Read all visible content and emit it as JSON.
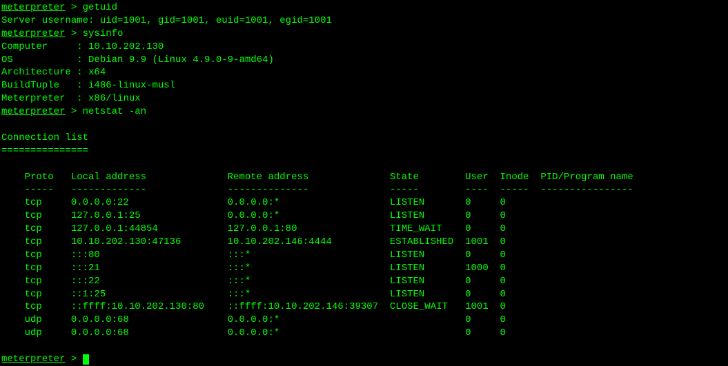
{
  "prompt": "meterpreter",
  "separator": " > ",
  "commands": {
    "getuid": "getuid",
    "sysinfo": "sysinfo",
    "netstat": "netstat -an"
  },
  "getuid_output": "Server username: uid=1001, gid=1001, euid=1001, egid=1001",
  "sysinfo": {
    "computer_label": "Computer     : ",
    "computer_value": "10.10.202.130",
    "os_label": "OS           : ",
    "os_value": "Debian 9.9 (Linux 4.9.0-9-amd64)",
    "arch_label": "Architecture : ",
    "arch_value": "x64",
    "buildtuple_label": "BuildTuple   : ",
    "buildtuple_value": "i486-linux-musl",
    "meterpreter_label": "Meterpreter  : ",
    "meterpreter_value": "x86/linux"
  },
  "netstat": {
    "title": "Connection list",
    "divider": "===============",
    "headers": {
      "proto": "Proto",
      "local": "Local address",
      "remote": "Remote address",
      "state": "State",
      "user": "User",
      "inode": "Inode",
      "pidprog": "PID/Program name"
    },
    "header_divider": {
      "proto": "-----",
      "local": "-------------",
      "remote": "--------------",
      "state": "-----",
      "user": "----",
      "inode": "-----",
      "pidprog": "----------------"
    },
    "rows": [
      {
        "proto": "tcp",
        "local": "0.0.0.0:22",
        "remote": "0.0.0.0:*",
        "state": "LISTEN",
        "user": "0",
        "inode": "0",
        "pidprog": ""
      },
      {
        "proto": "tcp",
        "local": "127.0.0.1:25",
        "remote": "0.0.0.0:*",
        "state": "LISTEN",
        "user": "0",
        "inode": "0",
        "pidprog": ""
      },
      {
        "proto": "tcp",
        "local": "127.0.0.1:44854",
        "remote": "127.0.0.1:80",
        "state": "TIME_WAIT",
        "user": "0",
        "inode": "0",
        "pidprog": ""
      },
      {
        "proto": "tcp",
        "local": "10.10.202.130:47136",
        "remote": "10.10.202.146:4444",
        "state": "ESTABLISHED",
        "user": "1001",
        "inode": "0",
        "pidprog": ""
      },
      {
        "proto": "tcp",
        "local": ":::80",
        "remote": ":::*",
        "state": "LISTEN",
        "user": "0",
        "inode": "0",
        "pidprog": ""
      },
      {
        "proto": "tcp",
        "local": ":::21",
        "remote": ":::*",
        "state": "LISTEN",
        "user": "1000",
        "inode": "0",
        "pidprog": ""
      },
      {
        "proto": "tcp",
        "local": ":::22",
        "remote": ":::*",
        "state": "LISTEN",
        "user": "0",
        "inode": "0",
        "pidprog": ""
      },
      {
        "proto": "tcp",
        "local": "::1:25",
        "remote": ":::*",
        "state": "LISTEN",
        "user": "0",
        "inode": "0",
        "pidprog": ""
      },
      {
        "proto": "tcp",
        "local": "::ffff:10.10.202.130:80",
        "remote": "::ffff:10.10.202.146:39307",
        "state": "CLOSE_WAIT",
        "user": "1001",
        "inode": "0",
        "pidprog": ""
      },
      {
        "proto": "udp",
        "local": "0.0.0.0:68",
        "remote": "0.0.0.0:*",
        "state": "",
        "user": "0",
        "inode": "0",
        "pidprog": ""
      },
      {
        "proto": "udp",
        "local": "0.0.0.0:68",
        "remote": "0.0.0.0:*",
        "state": "",
        "user": "0",
        "inode": "0",
        "pidprog": ""
      }
    ]
  },
  "chart_data": {
    "type": "table",
    "title": "Connection list",
    "columns": [
      "Proto",
      "Local address",
      "Remote address",
      "State",
      "User",
      "Inode",
      "PID/Program name"
    ],
    "rows": [
      [
        "tcp",
        "0.0.0.0:22",
        "0.0.0.0:*",
        "LISTEN",
        0,
        0,
        ""
      ],
      [
        "tcp",
        "127.0.0.1:25",
        "0.0.0.0:*",
        "LISTEN",
        0,
        0,
        ""
      ],
      [
        "tcp",
        "127.0.0.1:44854",
        "127.0.0.1:80",
        "TIME_WAIT",
        0,
        0,
        ""
      ],
      [
        "tcp",
        "10.10.202.130:47136",
        "10.10.202.146:4444",
        "ESTABLISHED",
        1001,
        0,
        ""
      ],
      [
        "tcp",
        ":::80",
        ":::*",
        "LISTEN",
        0,
        0,
        ""
      ],
      [
        "tcp",
        ":::21",
        ":::*",
        "LISTEN",
        1000,
        0,
        ""
      ],
      [
        "tcp",
        ":::22",
        ":::*",
        "LISTEN",
        0,
        0,
        ""
      ],
      [
        "tcp",
        "::1:25",
        ":::*",
        "LISTEN",
        0,
        0,
        ""
      ],
      [
        "tcp",
        "::ffff:10.10.202.130:80",
        "::ffff:10.10.202.146:39307",
        "CLOSE_WAIT",
        1001,
        0,
        ""
      ],
      [
        "udp",
        "0.0.0.0:68",
        "0.0.0.0:*",
        "",
        0,
        0,
        ""
      ],
      [
        "udp",
        "0.0.0.0:68",
        "0.0.0.0:*",
        "",
        0,
        0,
        ""
      ]
    ]
  }
}
